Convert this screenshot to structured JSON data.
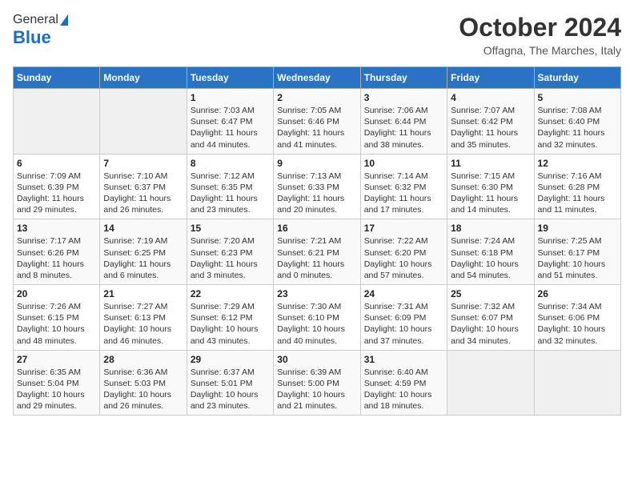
{
  "header": {
    "logo_general": "General",
    "logo_blue": "Blue",
    "title": "October 2024",
    "subtitle": "Offagna, The Marches, Italy"
  },
  "days_of_week": [
    "Sunday",
    "Monday",
    "Tuesday",
    "Wednesday",
    "Thursday",
    "Friday",
    "Saturday"
  ],
  "weeks": [
    [
      {
        "day": "",
        "info": ""
      },
      {
        "day": "",
        "info": ""
      },
      {
        "day": "1",
        "info": "Sunrise: 7:03 AM\nSunset: 6:47 PM\nDaylight: 11 hours and 44 minutes."
      },
      {
        "day": "2",
        "info": "Sunrise: 7:05 AM\nSunset: 6:46 PM\nDaylight: 11 hours and 41 minutes."
      },
      {
        "day": "3",
        "info": "Sunrise: 7:06 AM\nSunset: 6:44 PM\nDaylight: 11 hours and 38 minutes."
      },
      {
        "day": "4",
        "info": "Sunrise: 7:07 AM\nSunset: 6:42 PM\nDaylight: 11 hours and 35 minutes."
      },
      {
        "day": "5",
        "info": "Sunrise: 7:08 AM\nSunset: 6:40 PM\nDaylight: 11 hours and 32 minutes."
      }
    ],
    [
      {
        "day": "6",
        "info": "Sunrise: 7:09 AM\nSunset: 6:39 PM\nDaylight: 11 hours and 29 minutes."
      },
      {
        "day": "7",
        "info": "Sunrise: 7:10 AM\nSunset: 6:37 PM\nDaylight: 11 hours and 26 minutes."
      },
      {
        "day": "8",
        "info": "Sunrise: 7:12 AM\nSunset: 6:35 PM\nDaylight: 11 hours and 23 minutes."
      },
      {
        "day": "9",
        "info": "Sunrise: 7:13 AM\nSunset: 6:33 PM\nDaylight: 11 hours and 20 minutes."
      },
      {
        "day": "10",
        "info": "Sunrise: 7:14 AM\nSunset: 6:32 PM\nDaylight: 11 hours and 17 minutes."
      },
      {
        "day": "11",
        "info": "Sunrise: 7:15 AM\nSunset: 6:30 PM\nDaylight: 11 hours and 14 minutes."
      },
      {
        "day": "12",
        "info": "Sunrise: 7:16 AM\nSunset: 6:28 PM\nDaylight: 11 hours and 11 minutes."
      }
    ],
    [
      {
        "day": "13",
        "info": "Sunrise: 7:17 AM\nSunset: 6:26 PM\nDaylight: 11 hours and 8 minutes."
      },
      {
        "day": "14",
        "info": "Sunrise: 7:19 AM\nSunset: 6:25 PM\nDaylight: 11 hours and 6 minutes."
      },
      {
        "day": "15",
        "info": "Sunrise: 7:20 AM\nSunset: 6:23 PM\nDaylight: 11 hours and 3 minutes."
      },
      {
        "day": "16",
        "info": "Sunrise: 7:21 AM\nSunset: 6:21 PM\nDaylight: 11 hours and 0 minutes."
      },
      {
        "day": "17",
        "info": "Sunrise: 7:22 AM\nSunset: 6:20 PM\nDaylight: 10 hours and 57 minutes."
      },
      {
        "day": "18",
        "info": "Sunrise: 7:24 AM\nSunset: 6:18 PM\nDaylight: 10 hours and 54 minutes."
      },
      {
        "day": "19",
        "info": "Sunrise: 7:25 AM\nSunset: 6:17 PM\nDaylight: 10 hours and 51 minutes."
      }
    ],
    [
      {
        "day": "20",
        "info": "Sunrise: 7:26 AM\nSunset: 6:15 PM\nDaylight: 10 hours and 48 minutes."
      },
      {
        "day": "21",
        "info": "Sunrise: 7:27 AM\nSunset: 6:13 PM\nDaylight: 10 hours and 46 minutes."
      },
      {
        "day": "22",
        "info": "Sunrise: 7:29 AM\nSunset: 6:12 PM\nDaylight: 10 hours and 43 minutes."
      },
      {
        "day": "23",
        "info": "Sunrise: 7:30 AM\nSunset: 6:10 PM\nDaylight: 10 hours and 40 minutes."
      },
      {
        "day": "24",
        "info": "Sunrise: 7:31 AM\nSunset: 6:09 PM\nDaylight: 10 hours and 37 minutes."
      },
      {
        "day": "25",
        "info": "Sunrise: 7:32 AM\nSunset: 6:07 PM\nDaylight: 10 hours and 34 minutes."
      },
      {
        "day": "26",
        "info": "Sunrise: 7:34 AM\nSunset: 6:06 PM\nDaylight: 10 hours and 32 minutes."
      }
    ],
    [
      {
        "day": "27",
        "info": "Sunrise: 6:35 AM\nSunset: 5:04 PM\nDaylight: 10 hours and 29 minutes."
      },
      {
        "day": "28",
        "info": "Sunrise: 6:36 AM\nSunset: 5:03 PM\nDaylight: 10 hours and 26 minutes."
      },
      {
        "day": "29",
        "info": "Sunrise: 6:37 AM\nSunset: 5:01 PM\nDaylight: 10 hours and 23 minutes."
      },
      {
        "day": "30",
        "info": "Sunrise: 6:39 AM\nSunset: 5:00 PM\nDaylight: 10 hours and 21 minutes."
      },
      {
        "day": "31",
        "info": "Sunrise: 6:40 AM\nSunset: 4:59 PM\nDaylight: 10 hours and 18 minutes."
      },
      {
        "day": "",
        "info": ""
      },
      {
        "day": "",
        "info": ""
      }
    ]
  ]
}
